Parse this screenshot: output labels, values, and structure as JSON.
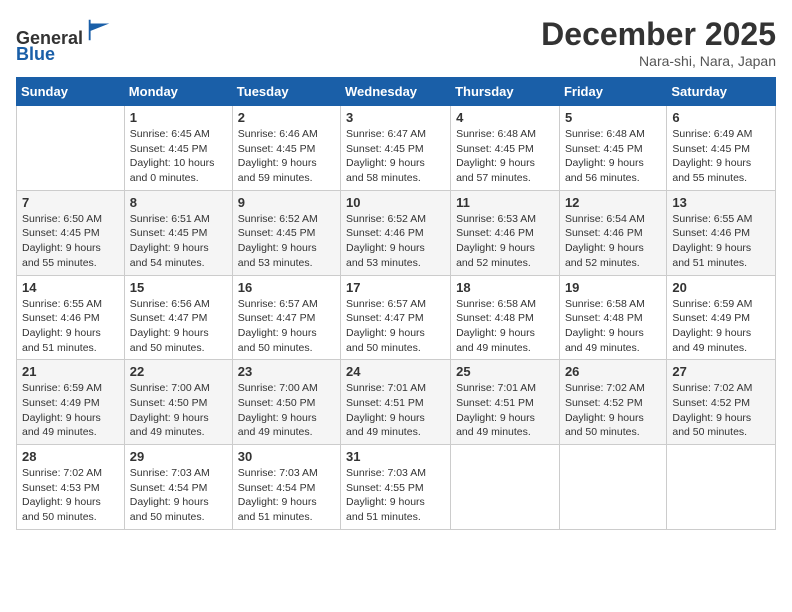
{
  "header": {
    "logo_line1": "General",
    "logo_line2": "Blue",
    "title": "December 2025",
    "subtitle": "Nara-shi, Nara, Japan"
  },
  "calendar": {
    "days_of_week": [
      "Sunday",
      "Monday",
      "Tuesday",
      "Wednesday",
      "Thursday",
      "Friday",
      "Saturday"
    ],
    "weeks": [
      [
        {
          "day": "",
          "info": ""
        },
        {
          "day": "1",
          "info": "Sunrise: 6:45 AM\nSunset: 4:45 PM\nDaylight: 10 hours\nand 0 minutes."
        },
        {
          "day": "2",
          "info": "Sunrise: 6:46 AM\nSunset: 4:45 PM\nDaylight: 9 hours\nand 59 minutes."
        },
        {
          "day": "3",
          "info": "Sunrise: 6:47 AM\nSunset: 4:45 PM\nDaylight: 9 hours\nand 58 minutes."
        },
        {
          "day": "4",
          "info": "Sunrise: 6:48 AM\nSunset: 4:45 PM\nDaylight: 9 hours\nand 57 minutes."
        },
        {
          "day": "5",
          "info": "Sunrise: 6:48 AM\nSunset: 4:45 PM\nDaylight: 9 hours\nand 56 minutes."
        },
        {
          "day": "6",
          "info": "Sunrise: 6:49 AM\nSunset: 4:45 PM\nDaylight: 9 hours\nand 55 minutes."
        }
      ],
      [
        {
          "day": "7",
          "info": "Sunrise: 6:50 AM\nSunset: 4:45 PM\nDaylight: 9 hours\nand 55 minutes."
        },
        {
          "day": "8",
          "info": "Sunrise: 6:51 AM\nSunset: 4:45 PM\nDaylight: 9 hours\nand 54 minutes."
        },
        {
          "day": "9",
          "info": "Sunrise: 6:52 AM\nSunset: 4:45 PM\nDaylight: 9 hours\nand 53 minutes."
        },
        {
          "day": "10",
          "info": "Sunrise: 6:52 AM\nSunset: 4:46 PM\nDaylight: 9 hours\nand 53 minutes."
        },
        {
          "day": "11",
          "info": "Sunrise: 6:53 AM\nSunset: 4:46 PM\nDaylight: 9 hours\nand 52 minutes."
        },
        {
          "day": "12",
          "info": "Sunrise: 6:54 AM\nSunset: 4:46 PM\nDaylight: 9 hours\nand 52 minutes."
        },
        {
          "day": "13",
          "info": "Sunrise: 6:55 AM\nSunset: 4:46 PM\nDaylight: 9 hours\nand 51 minutes."
        }
      ],
      [
        {
          "day": "14",
          "info": "Sunrise: 6:55 AM\nSunset: 4:46 PM\nDaylight: 9 hours\nand 51 minutes."
        },
        {
          "day": "15",
          "info": "Sunrise: 6:56 AM\nSunset: 4:47 PM\nDaylight: 9 hours\nand 50 minutes."
        },
        {
          "day": "16",
          "info": "Sunrise: 6:57 AM\nSunset: 4:47 PM\nDaylight: 9 hours\nand 50 minutes."
        },
        {
          "day": "17",
          "info": "Sunrise: 6:57 AM\nSunset: 4:47 PM\nDaylight: 9 hours\nand 50 minutes."
        },
        {
          "day": "18",
          "info": "Sunrise: 6:58 AM\nSunset: 4:48 PM\nDaylight: 9 hours\nand 49 minutes."
        },
        {
          "day": "19",
          "info": "Sunrise: 6:58 AM\nSunset: 4:48 PM\nDaylight: 9 hours\nand 49 minutes."
        },
        {
          "day": "20",
          "info": "Sunrise: 6:59 AM\nSunset: 4:49 PM\nDaylight: 9 hours\nand 49 minutes."
        }
      ],
      [
        {
          "day": "21",
          "info": "Sunrise: 6:59 AM\nSunset: 4:49 PM\nDaylight: 9 hours\nand 49 minutes."
        },
        {
          "day": "22",
          "info": "Sunrise: 7:00 AM\nSunset: 4:50 PM\nDaylight: 9 hours\nand 49 minutes."
        },
        {
          "day": "23",
          "info": "Sunrise: 7:00 AM\nSunset: 4:50 PM\nDaylight: 9 hours\nand 49 minutes."
        },
        {
          "day": "24",
          "info": "Sunrise: 7:01 AM\nSunset: 4:51 PM\nDaylight: 9 hours\nand 49 minutes."
        },
        {
          "day": "25",
          "info": "Sunrise: 7:01 AM\nSunset: 4:51 PM\nDaylight: 9 hours\nand 49 minutes."
        },
        {
          "day": "26",
          "info": "Sunrise: 7:02 AM\nSunset: 4:52 PM\nDaylight: 9 hours\nand 50 minutes."
        },
        {
          "day": "27",
          "info": "Sunrise: 7:02 AM\nSunset: 4:52 PM\nDaylight: 9 hours\nand 50 minutes."
        }
      ],
      [
        {
          "day": "28",
          "info": "Sunrise: 7:02 AM\nSunset: 4:53 PM\nDaylight: 9 hours\nand 50 minutes."
        },
        {
          "day": "29",
          "info": "Sunrise: 7:03 AM\nSunset: 4:54 PM\nDaylight: 9 hours\nand 50 minutes."
        },
        {
          "day": "30",
          "info": "Sunrise: 7:03 AM\nSunset: 4:54 PM\nDaylight: 9 hours\nand 51 minutes."
        },
        {
          "day": "31",
          "info": "Sunrise: 7:03 AM\nSunset: 4:55 PM\nDaylight: 9 hours\nand 51 minutes."
        },
        {
          "day": "",
          "info": ""
        },
        {
          "day": "",
          "info": ""
        },
        {
          "day": "",
          "info": ""
        }
      ]
    ]
  }
}
